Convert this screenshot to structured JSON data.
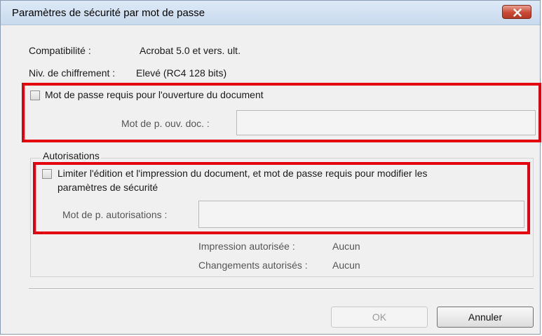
{
  "dialog": {
    "title": "Paramètres de sécurité par mot de passe"
  },
  "info": {
    "compat_label": "Compatibilité :",
    "compat_value": "Acrobat 5.0 et vers. ult.",
    "encryption_label": "Niv. de chiffrement :",
    "encryption_value": "Elevé (RC4 128 bits)"
  },
  "open_password": {
    "checkbox_label": "Mot de passe requis pour l'ouverture du document",
    "checked": false,
    "field_label": "Mot de p. ouv. doc. :",
    "field_value": ""
  },
  "permissions": {
    "group_label": "Autorisations",
    "checkbox_label_line1": "Limiter l'édition et l'impression du document, et mot de passe requis pour modifier les",
    "checkbox_label_line2": "paramètres de sécurité",
    "checked": false,
    "field_label": "Mot de p. autorisations :",
    "field_value": "",
    "printing_label": "Impression autorisée :",
    "printing_value": "Aucun",
    "changes_label": "Changements autorisés :",
    "changes_value": "Aucun"
  },
  "buttons": {
    "ok_label": "OK",
    "cancel_label": "Annuler"
  },
  "colors": {
    "highlight": "#e3000f",
    "close_button": "#c94a34"
  },
  "icons": {
    "close": "close-icon"
  }
}
